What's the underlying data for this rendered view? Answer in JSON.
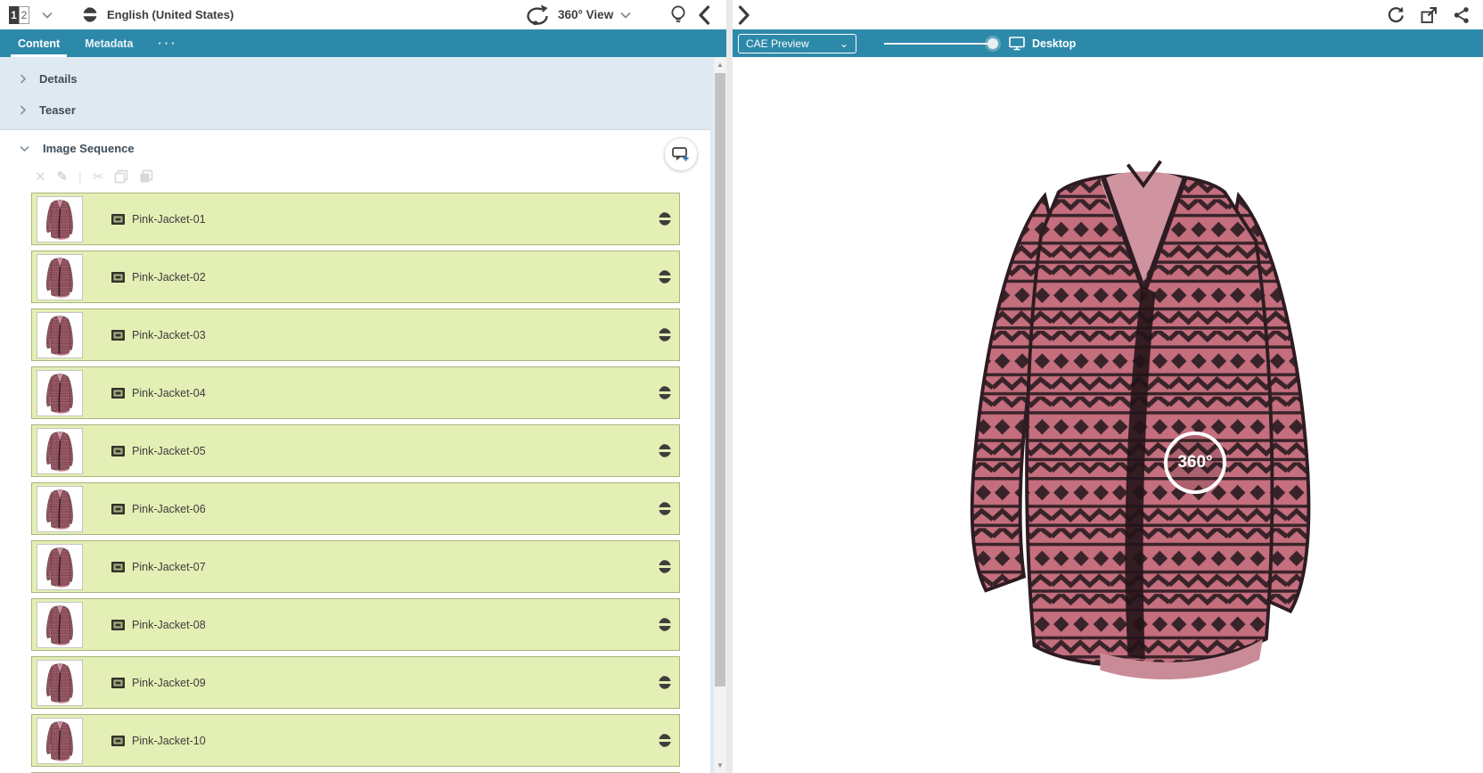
{
  "header": {
    "version_1": "1",
    "version_2": "2",
    "locale": "English (United States)",
    "title": "360° View"
  },
  "tabs": {
    "content": "Content",
    "metadata": "Metadata",
    "more": "···"
  },
  "sections": {
    "details": "Details",
    "teaser": "Teaser",
    "image_sequence": "Image Sequence"
  },
  "sequence_items": [
    {
      "label": "Pink-Jacket-01"
    },
    {
      "label": "Pink-Jacket-02"
    },
    {
      "label": "Pink-Jacket-03"
    },
    {
      "label": "Pink-Jacket-04"
    },
    {
      "label": "Pink-Jacket-05"
    },
    {
      "label": "Pink-Jacket-06"
    },
    {
      "label": "Pink-Jacket-07"
    },
    {
      "label": "Pink-Jacket-08"
    },
    {
      "label": "Pink-Jacket-09"
    },
    {
      "label": "Pink-Jacket-10"
    }
  ],
  "preview_toolbar": {
    "mode_selector": "CAE Preview",
    "device_label": "Desktop"
  },
  "preview": {
    "badge_label": "360°"
  },
  "icons": {
    "remove": "✕",
    "edit": "✎",
    "separator": "|",
    "cut": "✂",
    "scroll_up": "▲",
    "scroll_down": "▼",
    "select_chevron": "⌄"
  },
  "colors": {
    "teal": "#2d89aa",
    "panel_blue": "#dfe9f2",
    "row_green": "#e3efb4",
    "row_border": "#a9b47e",
    "jacket_pink": "#c46e7e",
    "jacket_dark": "#382329",
    "text_dark": "#3d3d3d"
  }
}
